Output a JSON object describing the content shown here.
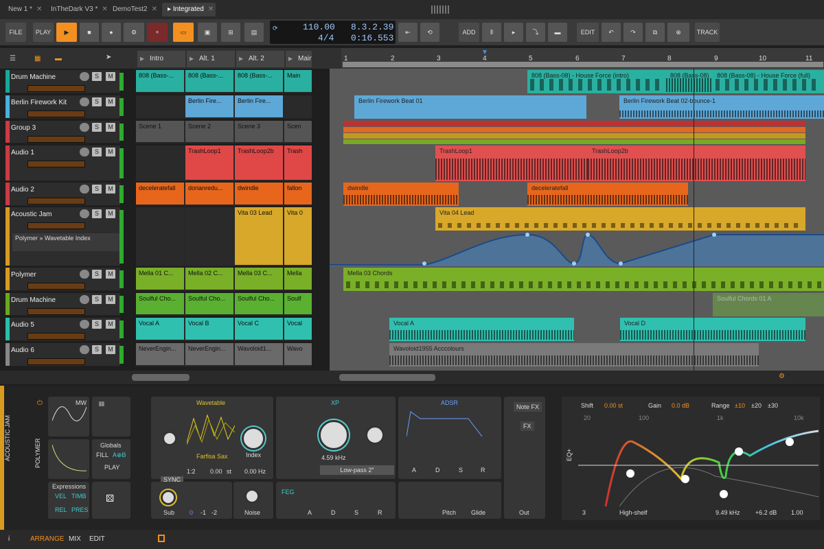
{
  "tabs": [
    {
      "label": "New 1 *"
    },
    {
      "label": "InTheDark V3 *"
    },
    {
      "label": "DemoTest2"
    },
    {
      "label": "Integrated"
    }
  ],
  "toolbar": {
    "file": "FILE",
    "play": "PLAY",
    "add": "ADD",
    "edit": "EDIT",
    "track": "TRACK"
  },
  "transport": {
    "tempo": "110.00",
    "signature": "4/4",
    "position": "8.3.2.39",
    "time": "0:16.553"
  },
  "scenes": [
    "Intro",
    "Alt. 1",
    "Alt. 2",
    "Main"
  ],
  "ruler": [
    "1",
    "2",
    "3",
    "4",
    "5",
    "6",
    "7",
    "8",
    "9",
    "10",
    "11"
  ],
  "tracks": [
    {
      "name": "Drum Machine",
      "color": "#18a89a"
    },
    {
      "name": "Berlin Firework Kit",
      "color": "#4ab0e0"
    },
    {
      "name": "Group 3",
      "color": "#cc3a44"
    },
    {
      "name": "Audio 1",
      "color": "#cc3a44"
    },
    {
      "name": "Audio 2",
      "color": "#cc3a44"
    },
    {
      "name": "Acoustic Jam",
      "color": "#d89a20"
    },
    {
      "name": "Polymer",
      "color": "#d89a20"
    },
    {
      "name": "Drum Machine",
      "color": "#6aa820"
    },
    {
      "name": "Audio 5",
      "color": "#28c0a8"
    },
    {
      "name": "Audio 6",
      "color": "#888888"
    }
  ],
  "device_chain": {
    "preset": "Polymer » Wavetable Index"
  },
  "launcher_clips": [
    [
      "808 (Bass-...",
      "808 (Bass-...",
      "808 (Bass-...",
      "Main"
    ],
    [
      "",
      "Berlin Fire...",
      "Berlin Fire...",
      ""
    ],
    [
      "Scene 1",
      "Scene 2",
      "Scene 3",
      "Scen"
    ],
    [
      "",
      "TrashLoop1",
      "TrashLoop2b",
      "Trash"
    ],
    [
      "deceleratefall",
      "dorianredu...",
      "dwindle",
      "fallon"
    ],
    [
      "",
      "",
      "Vita 03 Lead",
      "Vita 0"
    ],
    [
      "Mella 01 C...",
      "Mella 02 C...",
      "Mella 03 C...",
      "Mella"
    ],
    [
      "Soulful Cho...",
      "Soulful Cho...",
      "Soulful Cho...",
      "Soulf"
    ],
    [
      "Vocal A",
      "Vocal B",
      "Vocal C",
      "Vocal"
    ],
    [
      "NeverEngin...",
      "NeverEngin...",
      "Wavoloid1...",
      "Wavo"
    ]
  ],
  "arrange_clips": {
    "c808a": "808 (Bass-08) - House Force (intro)",
    "c808b": "808 (Bass-08)",
    "c808c": "808 (Bass-08) - House Force (full)",
    "berlin1": "Berlin Firework Beat 01",
    "berlin2": "Berlin Firework Beat 02-bounce-1",
    "trash1": "TrashLoop1",
    "trash2": "TrashLoop2b",
    "dwindle": "dwindle",
    "decel": "deceleratefall",
    "vita": "Vita 04 Lead",
    "mella": "Mella 03 Chords",
    "soulful": "Soulful Chords 01 A",
    "vocala": "Vocal A",
    "vocald": "Vocal D",
    "wavoloid": "Wavoloid1955 Acccolours"
  },
  "device": {
    "name": "ACOUSTIC JAM",
    "polymer": "POLYMER",
    "mw": "MW",
    "globals": "Globals",
    "fill": "FILL",
    "ab": "A⊕B",
    "play": "PLAY",
    "expressions": "Expressions",
    "vel": "VEL",
    "timb": "TIMB",
    "rel": "REL",
    "pres": "PRES",
    "wavetable": "Wavetable",
    "wt_preset": "Farfisa Sax",
    "index": "Index",
    "ratio": "1:2",
    "st": "0.00",
    "st_unit": "st",
    "hz": "0.00 Hz",
    "sync": "SYNC",
    "sub": "Sub",
    "octaves": "0",
    "oct1": "-1",
    "oct2": "-2",
    "noise": "Noise",
    "filter": "XP",
    "freq": "4.59 kHz",
    "filter_type": "Low-pass 2″",
    "feg": "FEG",
    "adsr": "ADSR",
    "a": "A",
    "d": "D",
    "s": "S",
    "r": "R",
    "pitch": "Pitch",
    "glide": "Glide",
    "out": "Out",
    "notefx": "Note FX",
    "fx": "FX"
  },
  "eq": {
    "name": "EQ+",
    "shift_label": "Shift",
    "shift": "0.00 st",
    "gain_label": "Gain",
    "gain": "0.0 dB",
    "range_label": "Range",
    "r1": "±10",
    "r2": "±20",
    "r3": "±30",
    "f20": "20",
    "f100": "100",
    "f1k": "1k",
    "f10k": "10k",
    "band": "3",
    "band_type": "High-shelf",
    "freq": "9.49 kHz",
    "db": "+6.2 dB",
    "q": "1.00"
  },
  "status": {
    "arrange": "ARRANGE",
    "mix": "MIX",
    "edit": "EDIT"
  }
}
